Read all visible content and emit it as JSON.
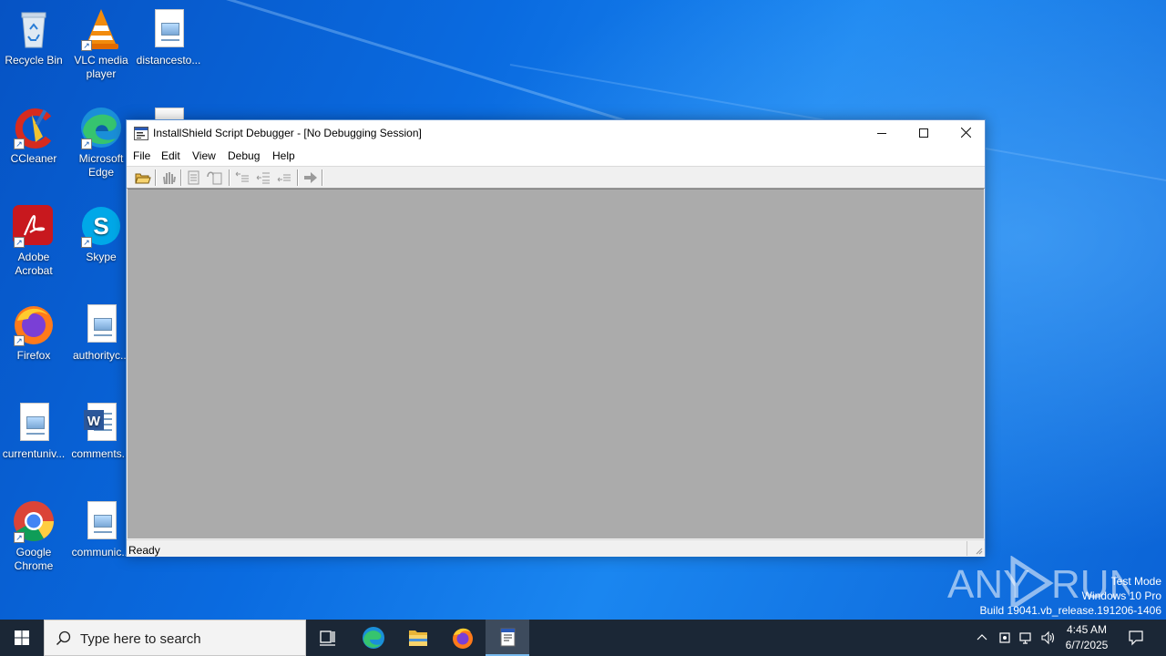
{
  "desktop": {
    "icons": [
      {
        "label": "Recycle Bin",
        "icon": "recycle-bin-icon"
      },
      {
        "label": "VLC media player",
        "icon": "vlc-icon"
      },
      {
        "label": "distancesto...",
        "icon": "image-file-icon"
      },
      {
        "label": "CCleaner",
        "icon": "ccleaner-icon"
      },
      {
        "label": "Microsoft Edge",
        "icon": "edge-icon"
      },
      {
        "label": "Adobe Acrobat",
        "icon": "acrobat-icon"
      },
      {
        "label": "Skype",
        "icon": "skype-icon"
      },
      {
        "label": "Firefox",
        "icon": "firefox-icon"
      },
      {
        "label": "authorityc...",
        "icon": "image-file-icon"
      },
      {
        "label": "currentuniv...",
        "icon": "image-file-icon"
      },
      {
        "label": "comments...",
        "icon": "word-file-icon"
      },
      {
        "label": "Google Chrome",
        "icon": "chrome-icon"
      },
      {
        "label": "communic...",
        "icon": "image-file-icon"
      }
    ]
  },
  "window": {
    "title": "InstallShield Script Debugger - [No Debugging Session]",
    "controls": {
      "minimize": "minimize",
      "maximize": "maximize",
      "close": "close"
    },
    "menu": [
      "File",
      "Edit",
      "View",
      "Debug",
      "Help"
    ],
    "toolbar": [
      "open-icon",
      "stop-hand-icon",
      "step-into-icon",
      "step-over-icon",
      "breakpoint-icon",
      "clear-breakpoint-icon",
      "watch-icon",
      "go-icon"
    ],
    "status": "Ready"
  },
  "watermark": {
    "brand": "ANY RUN",
    "lines": [
      "Test Mode",
      "Windows 10 Pro",
      "Build 19041.vb_release.191206-1406"
    ]
  },
  "taskbar": {
    "search_placeholder": "Type here to search",
    "time": "4:45 AM",
    "date": "6/7/2025",
    "accent": "#76b9ed"
  }
}
